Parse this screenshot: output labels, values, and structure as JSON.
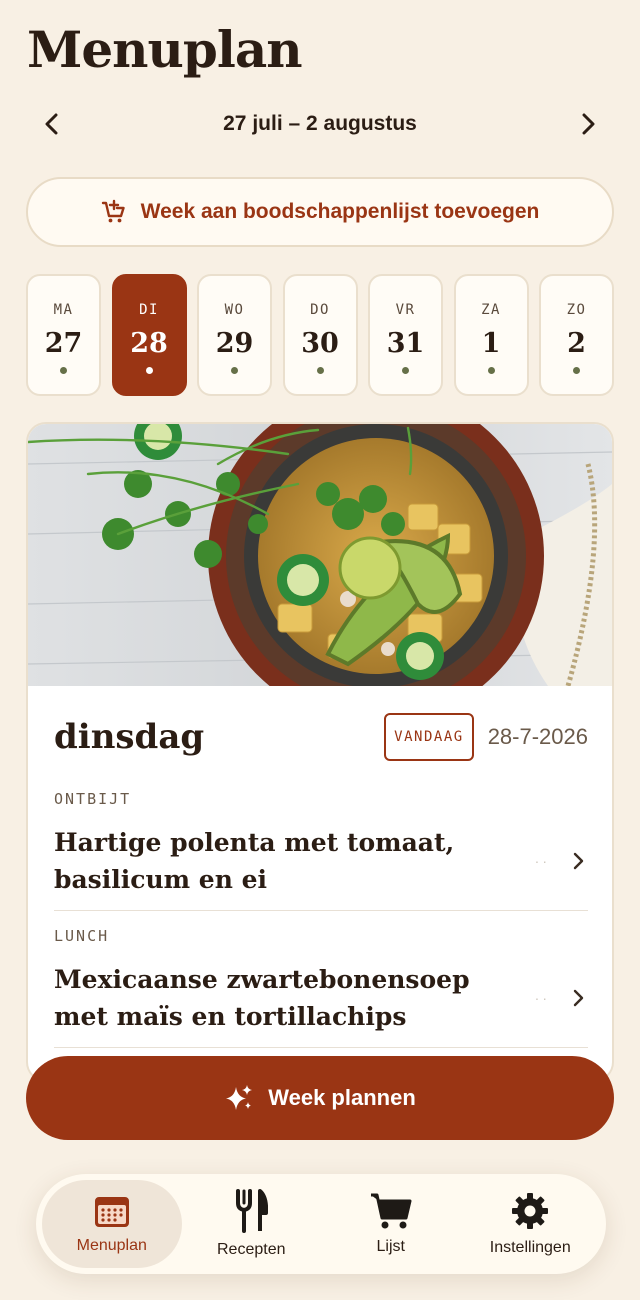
{
  "header": {
    "title": "Menuplan"
  },
  "week_nav": {
    "range": "27 juli – 2 augustus"
  },
  "add_to_list": {
    "label": "Week aan boodschappenlijst toevoegen"
  },
  "days": [
    {
      "abbr": "MA",
      "num": "27"
    },
    {
      "abbr": "DI",
      "num": "28",
      "selected": true
    },
    {
      "abbr": "WO",
      "num": "29"
    },
    {
      "abbr": "DO",
      "num": "30"
    },
    {
      "abbr": "VR",
      "num": "31"
    },
    {
      "abbr": "ZA",
      "num": "1"
    },
    {
      "abbr": "ZO",
      "num": "2"
    }
  ],
  "day_card": {
    "name": "dinsdag",
    "badge": "VANDAAG",
    "date": "28-7-2026",
    "meals": [
      {
        "type": "ONTBIJT",
        "title": "Hartige polenta met tomaat, basilicum en ei"
      },
      {
        "type": "LUNCH",
        "title": "Mexicaanse zwartebonensoep met maïs en tortillachips"
      }
    ]
  },
  "plan_button": {
    "label": "Week plannen"
  },
  "tabbar": {
    "tabs": [
      {
        "label": "Menuplan",
        "icon": "calendar-icon",
        "active": true
      },
      {
        "label": "Recepten",
        "icon": "fork-knife-icon"
      },
      {
        "label": "Lijst",
        "icon": "cart-icon"
      },
      {
        "label": "Instellingen",
        "icon": "gear-icon"
      }
    ]
  },
  "colors": {
    "accent": "#9a3514",
    "background": "#f8f0e4",
    "dot": "#667048"
  }
}
